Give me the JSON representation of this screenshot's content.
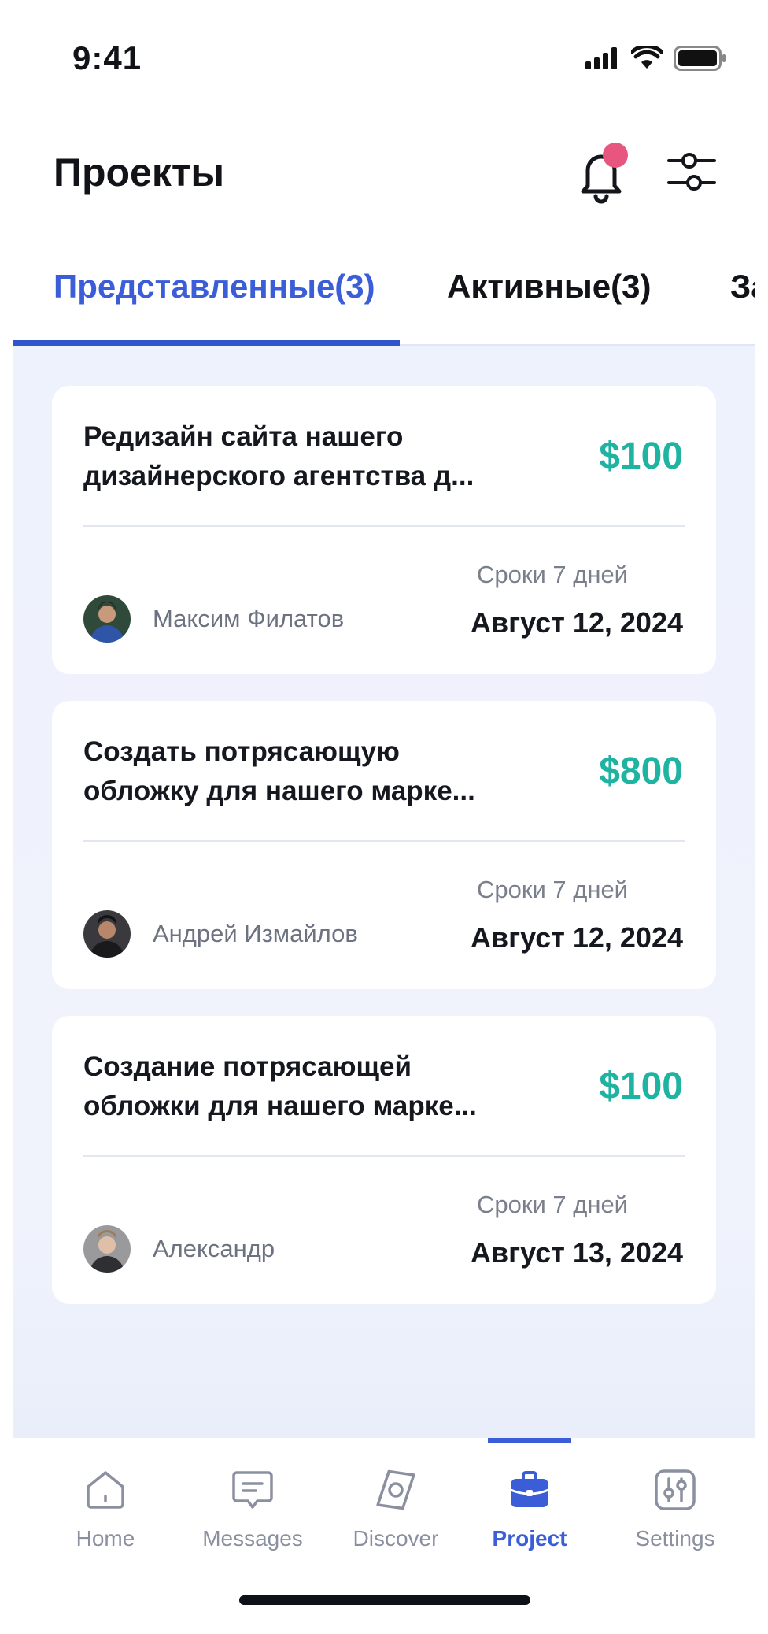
{
  "status_bar": {
    "time": "9:41"
  },
  "header": {
    "title": "Проекты"
  },
  "tabs": [
    {
      "label": "Представленные(3)",
      "active": true
    },
    {
      "label": "Активные(3)",
      "active": false
    },
    {
      "label": "За",
      "active": false
    }
  ],
  "projects": [
    {
      "title": "Редизайн сайта нашего дизайнерского агентства д...",
      "price": "$100",
      "person": "Максим Филатов",
      "deadline_label": "Сроки 7 дней",
      "date": "Август 12, 2024"
    },
    {
      "title": "Создать потрясающую обложку для нашего марке...",
      "price": "$800",
      "person": "Андрей Измайлов",
      "deadline_label": "Сроки 7 дней",
      "date": "Август 12, 2024"
    },
    {
      "title": "Создание потрясающей обложки для нашего марке...",
      "price": "$100",
      "person": "Александр",
      "deadline_label": "Сроки 7 дней",
      "date": "Август 13, 2024"
    }
  ],
  "nav": [
    {
      "label": "Home",
      "icon": "home-icon",
      "active": false
    },
    {
      "label": "Messages",
      "icon": "messages-icon",
      "active": false
    },
    {
      "label": "Discover",
      "icon": "discover-icon",
      "active": false
    },
    {
      "label": "Project",
      "icon": "briefcase-icon",
      "active": true
    },
    {
      "label": "Settings",
      "icon": "settings-icon",
      "active": false
    }
  ],
  "colors": {
    "accent": "#3b5ed8",
    "price": "#1fb3a2",
    "notification": "#e8557f",
    "content_bg": "#eef2fc"
  }
}
